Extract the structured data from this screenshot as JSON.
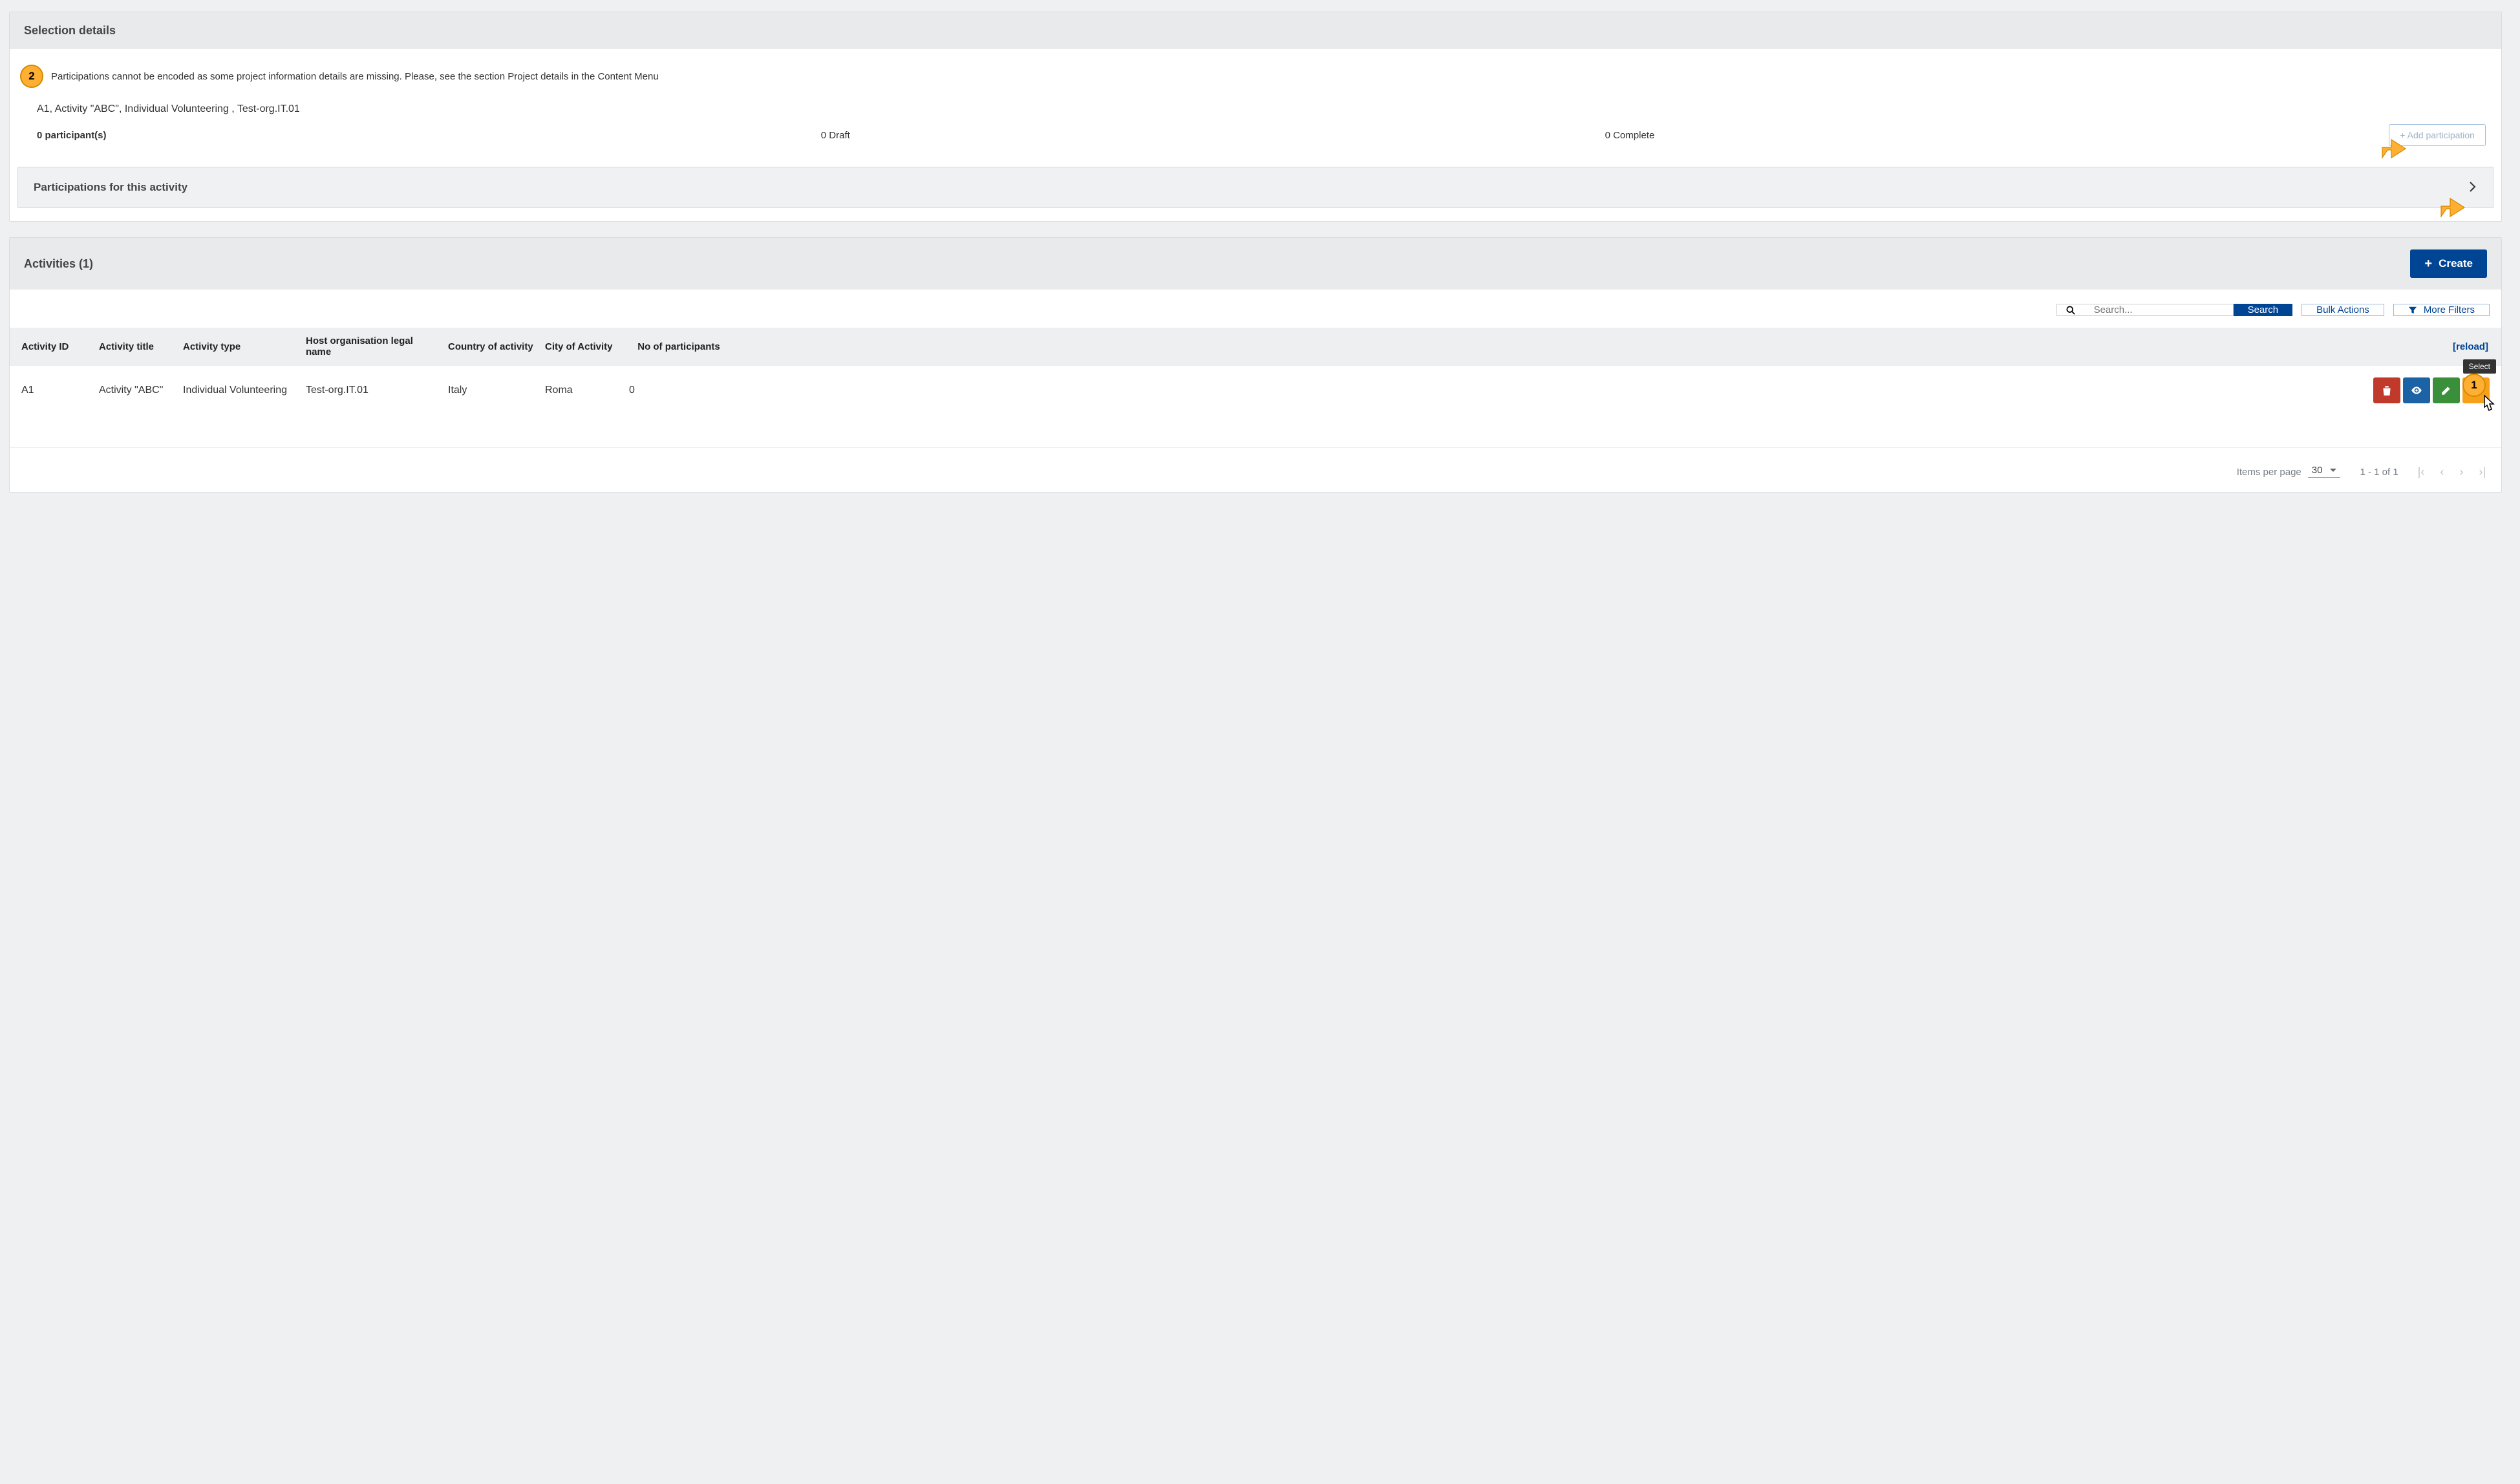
{
  "selection": {
    "header": "Selection details",
    "warning": "Participations cannot be encoded as some project information details are missing. Please, see the section Project details in the Content Menu",
    "activity_summary": "A1, Activity \"ABC\", Individual Volunteering , Test-org.IT.01",
    "stats": {
      "participants": "0 participant(s)",
      "draft": "0 Draft",
      "complete": "0 Complete"
    },
    "add_btn": "+ Add participation",
    "sub_header": "Participations for this activity"
  },
  "activities": {
    "header": "Activities (1)",
    "create_btn": "Create",
    "search": {
      "placeholder": "Search...",
      "button": "Search",
      "bulk": "Bulk Actions",
      "filters": "More Filters"
    },
    "columns": {
      "id": "Activity ID",
      "title": "Activity title",
      "type": "Activity type",
      "host": "Host organisation legal name",
      "country": "Country of activity",
      "city": "City of Activity",
      "np": "No of participants",
      "reload": "[reload]"
    },
    "row": {
      "id": "A1",
      "title": "Activity \"ABC\"",
      "type": "Individual Volunteering",
      "host": "Test-org.IT.01",
      "country": "Italy",
      "city": "Roma",
      "np": "0"
    },
    "tooltip_select": "Select",
    "footer": {
      "ipp_label": "Items per page",
      "ipp_value": "30",
      "range": "1 - 1 of 1"
    }
  },
  "annotations": {
    "c1": "1",
    "c2": "2"
  }
}
